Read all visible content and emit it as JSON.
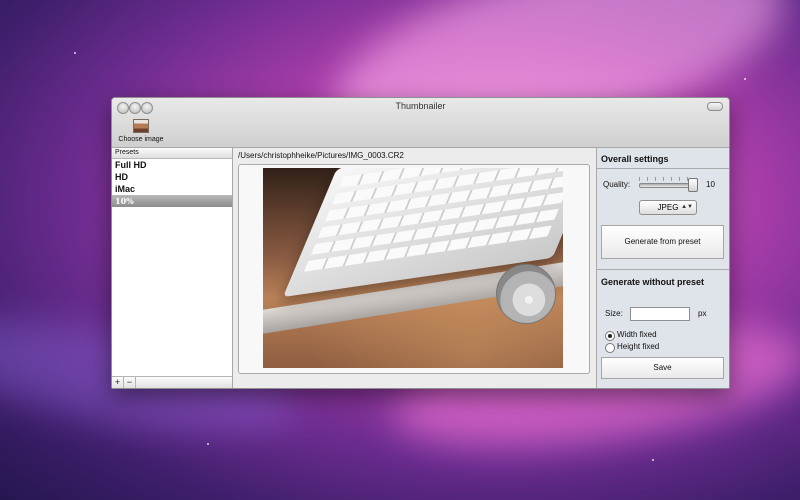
{
  "window": {
    "title": "Thumbnailer"
  },
  "toolbar": {
    "choose_image_label": "Choose image"
  },
  "sidebar": {
    "header": "Presets",
    "items": [
      {
        "label": "Full HD"
      },
      {
        "label": "HD"
      },
      {
        "label": "iMac"
      },
      {
        "label": "10%"
      }
    ],
    "add_label": "+",
    "remove_label": "−"
  },
  "main": {
    "file_path": "/Users/christophheike/Pictures/IMG_0003.CR2"
  },
  "overall": {
    "title": "Overall settings",
    "quality_label": "Quality:",
    "quality_value": "10",
    "format_value": "JPEG",
    "generate_label": "Generate from preset"
  },
  "without_preset": {
    "title": "Generate without preset",
    "size_label": "Size:",
    "size_value": "",
    "unit": "px",
    "width_fixed": "Width fixed",
    "height_fixed": "Height fixed",
    "save_label": "Save"
  }
}
